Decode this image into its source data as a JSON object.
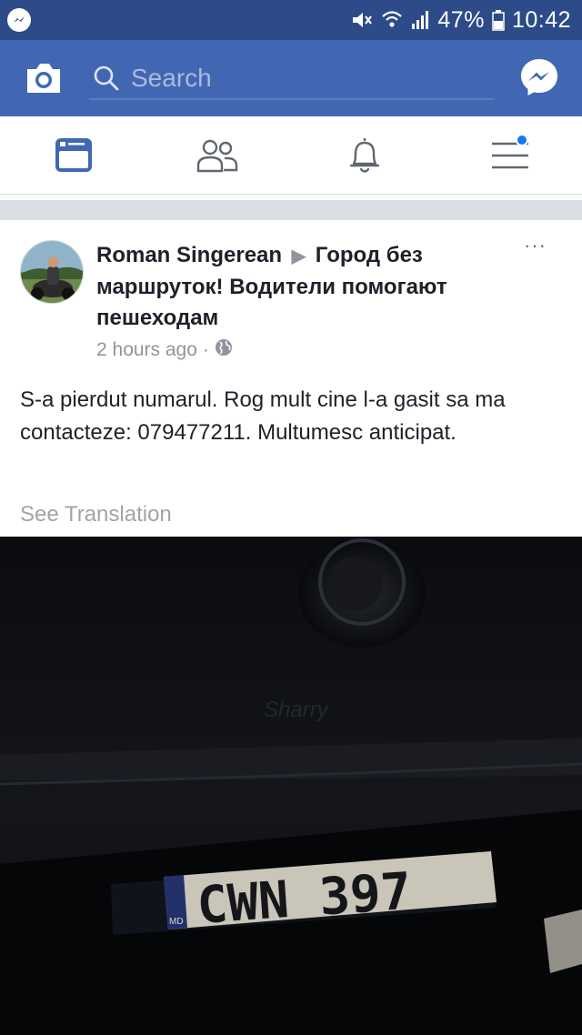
{
  "status_bar": {
    "battery": "47%",
    "time": "10:42"
  },
  "header": {
    "search_placeholder": "Search"
  },
  "tabs": [
    "news-feed",
    "friends",
    "notifications",
    "menu"
  ],
  "post": {
    "author": "Roman Singerean",
    "target": "Город без маршруток! Водители помогают пешеходам",
    "time": "2 hours ago",
    "separator": "·",
    "body": "S-a pierdut numarul. Rog mult cine l-a gasit sa ma contacteze: 079477211. Multumesc anticipat.",
    "translation_link": "See Translation",
    "more": "···",
    "photo": {
      "plate_text": "CWN 397",
      "plate_country": "MD"
    }
  },
  "colors": {
    "status_bar": "#2d4b88",
    "header": "#4267b2",
    "accent": "#1877f2",
    "text": "#1d2129",
    "muted": "#90949c"
  },
  "icons": [
    "messenger-notification-icon",
    "mute-icon",
    "wifi-icon",
    "signal-icon",
    "battery-icon",
    "camera-icon",
    "search-icon",
    "messenger-icon",
    "news-feed-icon",
    "friends-icon",
    "bell-icon",
    "menu-icon",
    "globe-icon",
    "more-icon"
  ]
}
